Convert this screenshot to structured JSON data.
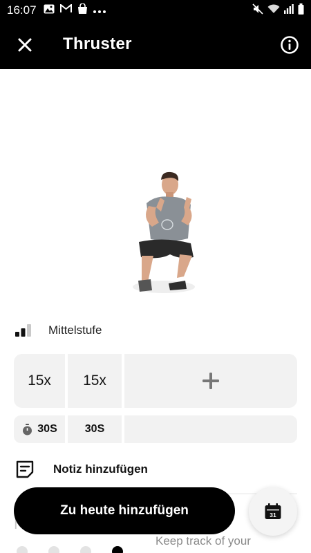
{
  "status_bar": {
    "time": "16:07",
    "left_icons": [
      "image-icon",
      "gmail-icon",
      "shopping-bag-icon",
      "more-dots-icon"
    ],
    "right_icons": [
      "mute-icon",
      "wifi-icon",
      "signal-icon",
      "battery-icon"
    ]
  },
  "header": {
    "title": "Thruster",
    "close_icon": "close-icon",
    "info_icon": "info-icon"
  },
  "exercise": {
    "level_label": "Mittelstufe",
    "sets": [
      {
        "reps": "15x",
        "rest": "30S"
      },
      {
        "reps": "15x",
        "rest": "30S"
      }
    ],
    "add_set_icon": "plus-icon"
  },
  "note": {
    "label": "Notiz hinzufügen"
  },
  "actions": {
    "add_today_label": "Zu heute hinzufügen",
    "calendar_day": "31"
  },
  "below": {
    "keep_track_text": "Keep track of your",
    "dots_count": 4,
    "active_dot": 3
  },
  "colors": {
    "header_bg": "#000000",
    "card_bg": "#f2f2f2",
    "cta_bg": "#000000"
  }
}
